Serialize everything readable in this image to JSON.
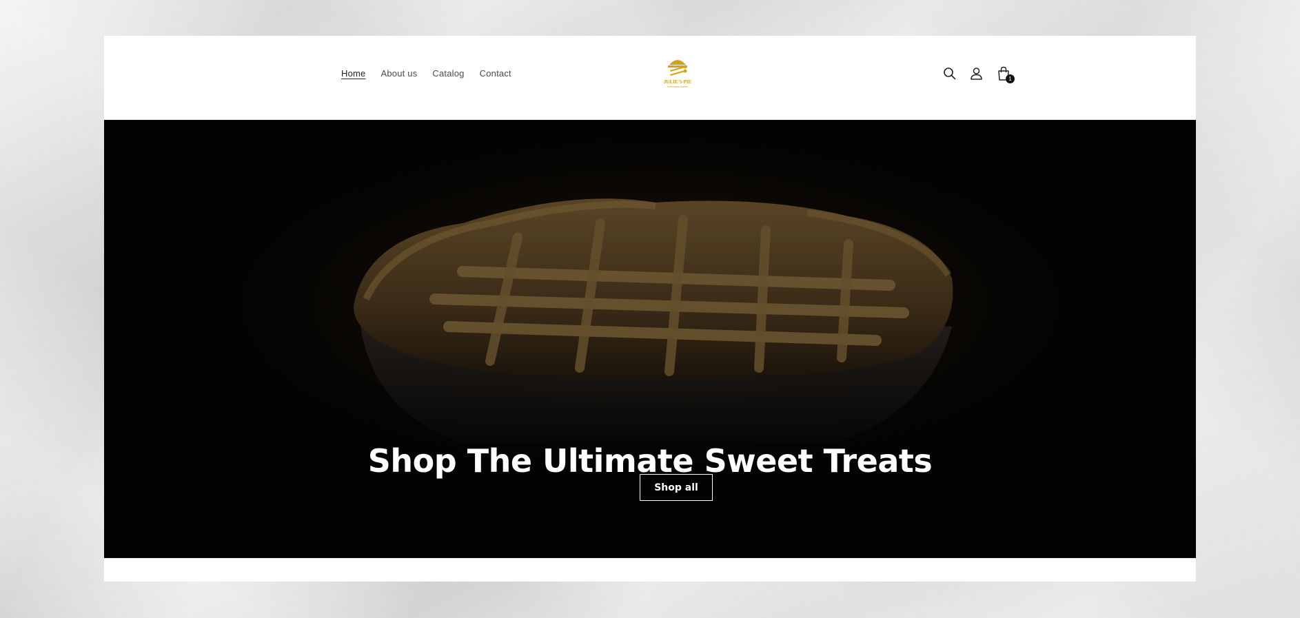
{
  "nav": {
    "items": [
      {
        "label": "Home",
        "active": true
      },
      {
        "label": "About us",
        "active": false
      },
      {
        "label": "Catalog",
        "active": false
      },
      {
        "label": "Contact",
        "active": false
      }
    ]
  },
  "logo": {
    "name": "JULIE'S PIE",
    "tagline": "homemade sweets",
    "icon": "pie-slice-icon",
    "color": "#d4a418"
  },
  "header_icons": {
    "search": "search-icon",
    "account": "user-icon",
    "cart": "shopping-bag-icon",
    "cart_count": "1"
  },
  "hero": {
    "title": "Shop The Ultimate Sweet Treats",
    "button_label": "Shop all"
  },
  "colors": {
    "accent": "#d4a418",
    "hero_bg": "#050505",
    "text_white": "#ffffff"
  }
}
